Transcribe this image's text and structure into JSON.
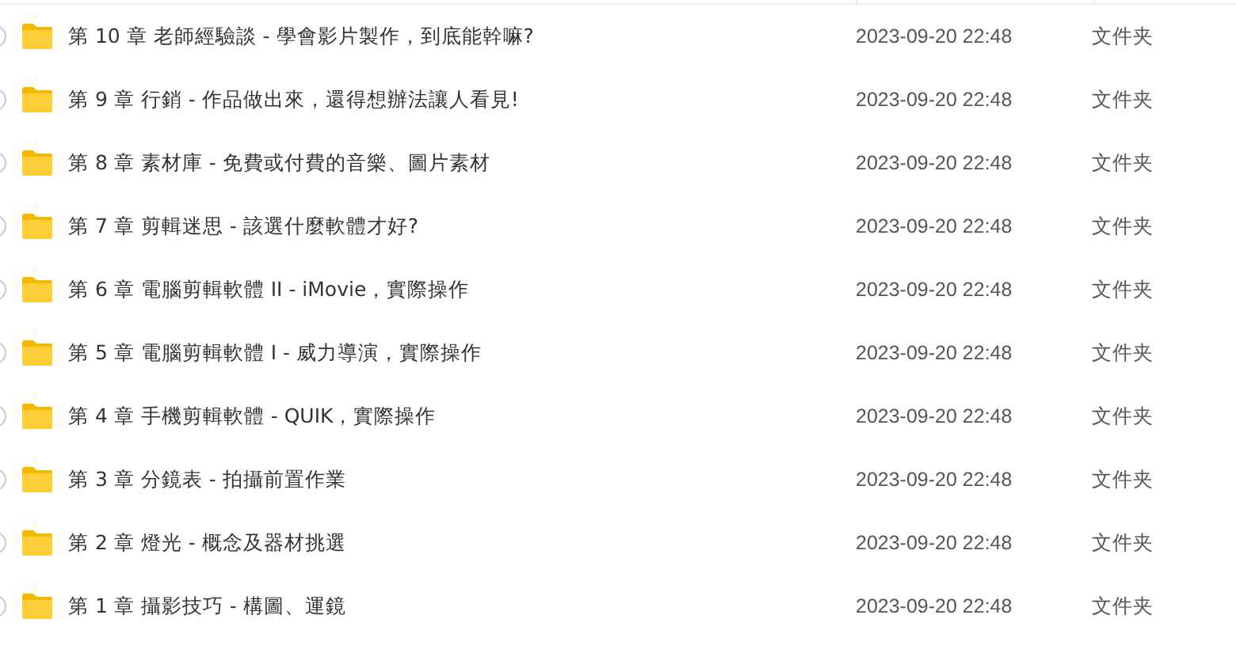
{
  "rows": [
    {
      "name": "第 10 章 老師經驗談 - 學會影片製作，到底能幹嘛?",
      "modified": "2023-09-20 22:48",
      "type": "文件夹",
      "checked": false
    },
    {
      "name": "第 9 章 行銷 - 作品做出來，還得想辦法讓人看見!",
      "modified": "2023-09-20 22:48",
      "type": "文件夹",
      "checked": false
    },
    {
      "name": "第 8 章 素材庫 - 免費或付費的音樂、圖片素材",
      "modified": "2023-09-20 22:48",
      "type": "文件夹",
      "checked": false
    },
    {
      "name": "第 7 章 剪輯迷思 - 該選什麼軟體才好?",
      "modified": "2023-09-20 22:48",
      "type": "文件夹",
      "checked": false
    },
    {
      "name": "第 6 章 電腦剪輯軟體 II - iMovie，實際操作",
      "modified": "2023-09-20 22:48",
      "type": "文件夹",
      "checked": false
    },
    {
      "name": "第 5 章 電腦剪輯軟體 I  - 威力導演，實際操作",
      "modified": "2023-09-20 22:48",
      "type": "文件夹",
      "checked": false
    },
    {
      "name": "第 4 章 手機剪輯軟體 - QUIK，實際操作",
      "modified": "2023-09-20 22:48",
      "type": "文件夹",
      "checked": false
    },
    {
      "name": "第 3 章 分鏡表 - 拍攝前置作業",
      "modified": "2023-09-20 22:48",
      "type": "文件夹",
      "checked": false
    },
    {
      "name": "第 2 章 燈光 - 概念及器材挑選",
      "modified": "2023-09-20 22:48",
      "type": "文件夹",
      "checked": false
    },
    {
      "name": "第 1 章 攝影技巧 - 構圖、運鏡",
      "modified": "2023-09-20 22:48",
      "type": "文件夹",
      "checked": false
    }
  ]
}
